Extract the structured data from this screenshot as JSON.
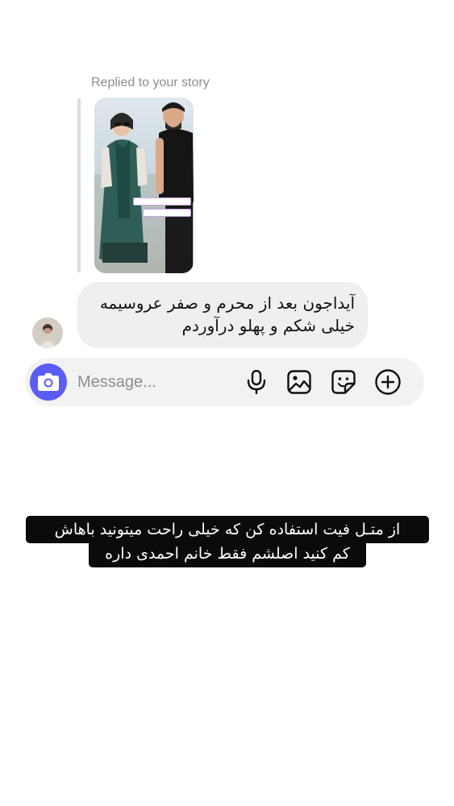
{
  "reply": {
    "label": "Replied to your story"
  },
  "message": {
    "text": "آیداجون بعد از محرم و صفر عروسیمه\nخیلی شکم و پهلو درآوردم"
  },
  "composer": {
    "placeholder": "Message...",
    "icons": [
      "camera-icon",
      "microphone-icon",
      "gallery-icon",
      "sticker-icon",
      "plus-icon"
    ],
    "accent_color": "#5b5cf6"
  },
  "caption": {
    "line1": "از متـل فیت استفاده کن که خیلی راحت میتونید باهاش",
    "line2": "کم کنید اصلشم فقط خانم احمدی داره"
  }
}
